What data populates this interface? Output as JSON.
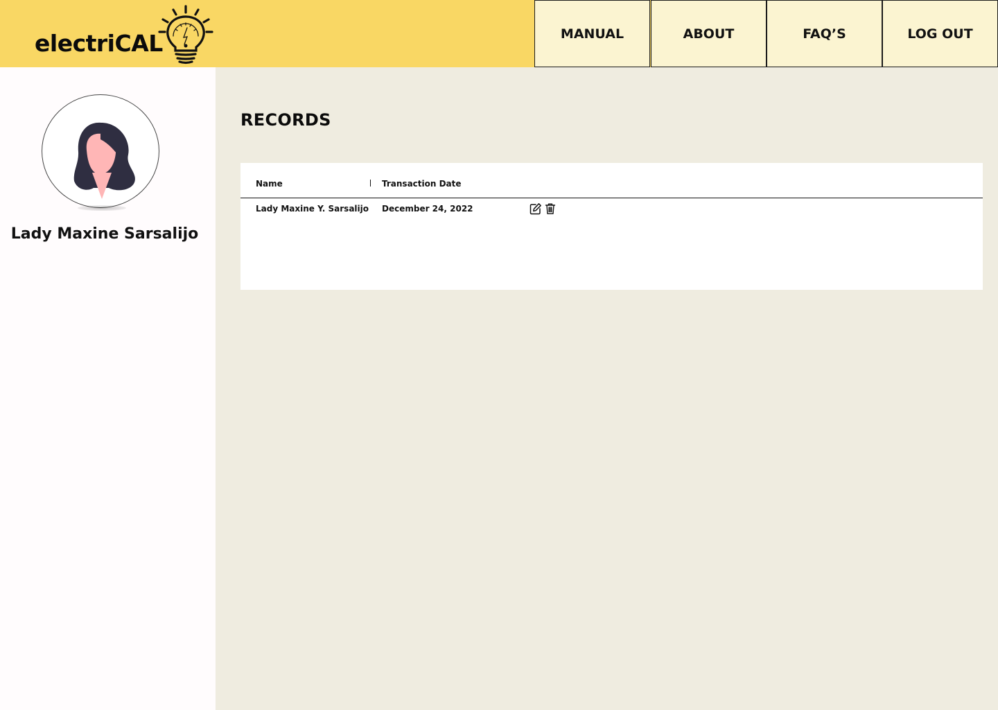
{
  "brand": {
    "name": "electriCAL",
    "logo_icon": "light-bulb-gauge-icon",
    "accent": "#f9d764"
  },
  "nav": {
    "manual": "MANUAL",
    "about": "ABOUT",
    "faqs": "FAQ’S",
    "logout": "LOG OUT"
  },
  "profile": {
    "name": "Lady Maxine Sarsalijo",
    "avatar_icon": "woman-avatar-icon"
  },
  "records": {
    "title": "RECORDS",
    "columns": {
      "name": "Name",
      "transaction_date": "Transaction Date"
    },
    "rows": [
      {
        "name": "Lady Maxine Y. Sarsalijo",
        "transaction_date": "December 24, 2022",
        "actions": [
          "edit-icon",
          "trash-icon"
        ]
      }
    ]
  },
  "colors": {
    "header": "#f9d764",
    "nav_button": "#fbf4d1",
    "content_bg": "#efece0",
    "sidebar_bg": "#fffcfd"
  }
}
